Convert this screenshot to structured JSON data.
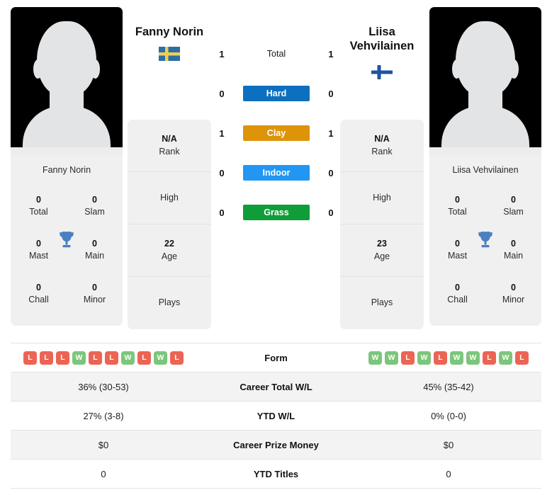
{
  "players": {
    "left": {
      "name": "Fanny Norin",
      "photo_name": "Fanny Norin",
      "flag": "sweden-flag",
      "rank": "N/A",
      "rank_label": "Rank",
      "high_label": "High",
      "high_value": "",
      "age": "22",
      "age_label": "Age",
      "plays_label": "Plays",
      "plays_value": "",
      "titles": {
        "total": "0",
        "total_label": "Total",
        "slam": "0",
        "slam_label": "Slam",
        "mast": "0",
        "mast_label": "Mast",
        "main": "0",
        "main_label": "Main",
        "chall": "0",
        "chall_label": "Chall",
        "minor": "0",
        "minor_label": "Minor"
      }
    },
    "right": {
      "name_line1": "Liisa",
      "name_line2": "Vehvilainen",
      "photo_name": "Liisa Vehvilainen",
      "flag": "finland-flag",
      "rank": "N/A",
      "rank_label": "Rank",
      "high_label": "High",
      "high_value": "",
      "age": "23",
      "age_label": "Age",
      "plays_label": "Plays",
      "plays_value": "",
      "titles": {
        "total": "0",
        "total_label": "Total",
        "slam": "0",
        "slam_label": "Slam",
        "mast": "0",
        "mast_label": "Mast",
        "main": "0",
        "main_label": "Main",
        "chall": "0",
        "chall_label": "Chall",
        "minor": "0",
        "minor_label": "Minor"
      }
    }
  },
  "h2h": {
    "rows": [
      {
        "label": "Total",
        "left": "1",
        "right": "1",
        "color": null,
        "style": "plain"
      },
      {
        "label": "Hard",
        "left": "0",
        "right": "0",
        "color": "#0d6fc0",
        "style": "badge"
      },
      {
        "label": "Clay",
        "left": "1",
        "right": "1",
        "color": "#dd9409",
        "style": "badge"
      },
      {
        "label": "Indoor",
        "left": "0",
        "right": "0",
        "color": "#2196f3",
        "style": "badge"
      },
      {
        "label": "Grass",
        "left": "0",
        "right": "0",
        "color": "#0f9d3a",
        "style": "badge"
      }
    ]
  },
  "form": {
    "label": "Form",
    "left": [
      "L",
      "L",
      "L",
      "W",
      "L",
      "L",
      "W",
      "L",
      "W",
      "L"
    ],
    "right": [
      "W",
      "W",
      "L",
      "W",
      "L",
      "W",
      "W",
      "L",
      "W",
      "L"
    ],
    "win_color": "#7cc67c",
    "loss_color": "#ec6454"
  },
  "stats_rows": [
    {
      "label": "Career Total W/L",
      "left": "36% (30-53)",
      "right": "45% (35-42)"
    },
    {
      "label": "YTD W/L",
      "left": "27% (3-8)",
      "right": "0% (0-0)"
    },
    {
      "label": "Career Prize Money",
      "left": "$0",
      "right": "$0"
    },
    {
      "label": "YTD Titles",
      "left": "0",
      "right": "0"
    }
  ]
}
